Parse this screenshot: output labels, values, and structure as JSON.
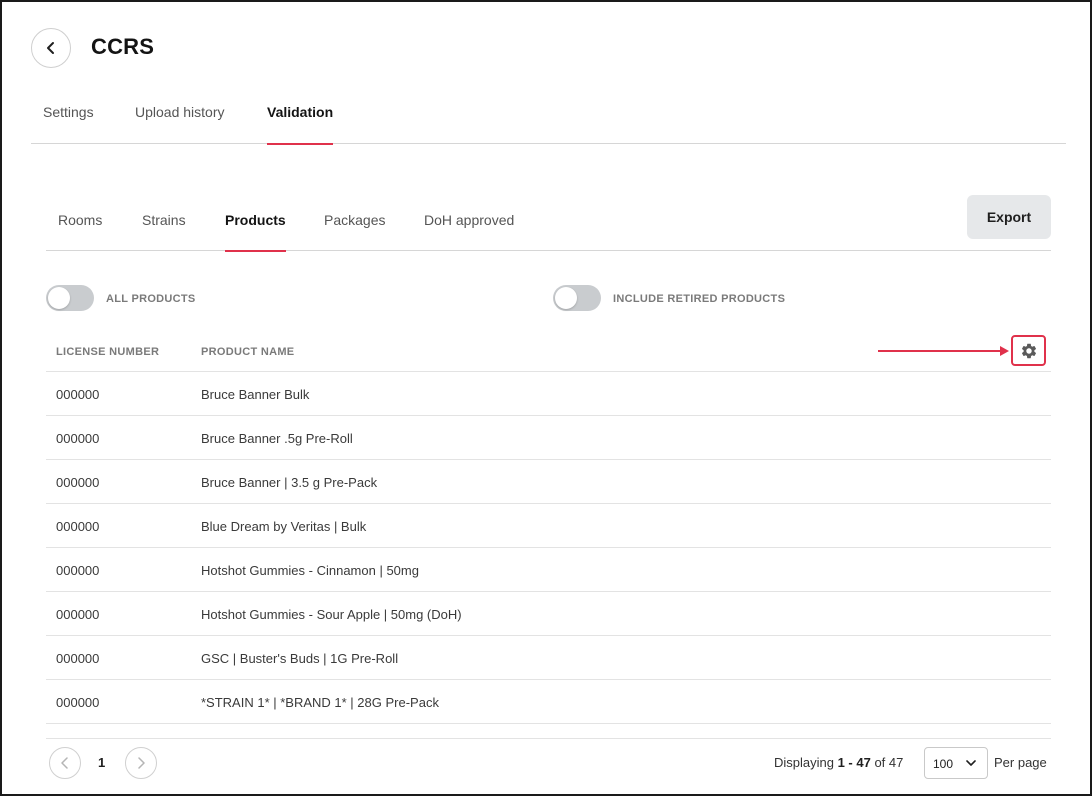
{
  "header": {
    "title": "CCRS"
  },
  "main_tabs": [
    {
      "label": "Settings",
      "active": false
    },
    {
      "label": "Upload history",
      "active": false
    },
    {
      "label": "Validation",
      "active": true
    }
  ],
  "sub_tabs": [
    {
      "label": "Rooms",
      "active": false
    },
    {
      "label": "Strains",
      "active": false
    },
    {
      "label": "Products",
      "active": true
    },
    {
      "label": "Packages",
      "active": false
    },
    {
      "label": "DoH approved",
      "active": false
    }
  ],
  "toolbar": {
    "export_label": "Export"
  },
  "toggles": {
    "all_products": {
      "label": "ALL PRODUCTS",
      "on": false
    },
    "include_retired": {
      "label": "INCLUDE RETIRED PRODUCTS",
      "on": false
    }
  },
  "table": {
    "columns": [
      "LICENSE NUMBER",
      "PRODUCT NAME"
    ],
    "rows": [
      {
        "license": "000000",
        "product": "Bruce Banner Bulk"
      },
      {
        "license": "000000",
        "product": "Bruce Banner .5g Pre-Roll"
      },
      {
        "license": "000000",
        "product": "Bruce Banner | 3.5 g Pre-Pack"
      },
      {
        "license": "000000",
        "product": "Blue Dream by Veritas | Bulk"
      },
      {
        "license": "000000",
        "product": "Hotshot Gummies - Cinnamon | 50mg"
      },
      {
        "license": "000000",
        "product": "Hotshot Gummies - Sour Apple | 50mg (DoH)"
      },
      {
        "license": "000000",
        "product": "GSC | Buster's Buds | 1G Pre-Roll"
      },
      {
        "license": "000000",
        "product": "*STRAIN 1* | *BRAND 1* | 28G Pre-Pack"
      }
    ]
  },
  "pagination": {
    "current_page": "1",
    "display_prefix": "Displaying ",
    "display_range": "1 - 47",
    "display_suffix": " of 47",
    "per_page_value": "100",
    "per_page_label": "Per page"
  },
  "icons": {
    "back": "chevron-left-icon",
    "settings": "gear-icon",
    "prev": "chevron-left-icon",
    "next": "chevron-right-icon",
    "dropdown": "chevron-down-icon"
  },
  "colors": {
    "accent": "#e0314b",
    "toggle_off": "#c9cccf",
    "export_bg": "#e6e8ea"
  }
}
